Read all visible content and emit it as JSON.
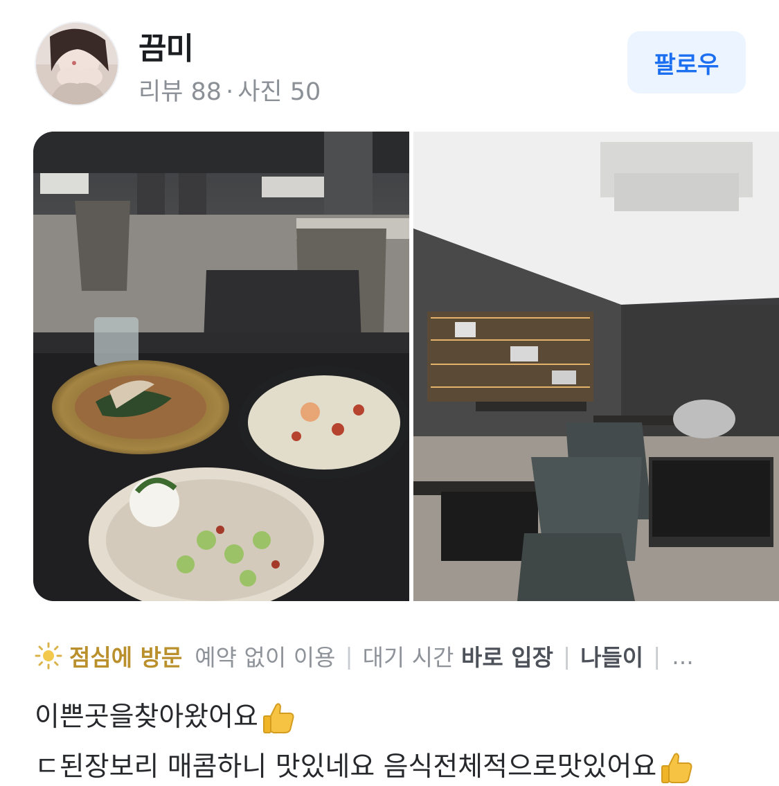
{
  "profile": {
    "name": "끔미",
    "review_label": "리뷰 88",
    "photo_label": "사진 50",
    "avatar_icon": "profile-avatar"
  },
  "follow": {
    "label": "팔로우"
  },
  "photos": [
    {
      "name": "food-photo"
    },
    {
      "name": "interior-photo"
    }
  ],
  "tags": {
    "visit_icon": "sun-icon",
    "visit": "점심에 방문",
    "reservation": "예약 없이 이용",
    "wait_prefix": "대기 시간",
    "wait_value": "바로 입장",
    "purpose": "나들이",
    "more": "..."
  },
  "review": {
    "line1": "이쁜곳을찾아왔어요",
    "line2": "ㄷ된장보리 매콤하니 맛있네요 음식전체적으로맛있어요",
    "emoji_icon": "thumbs-up-icon"
  },
  "colors": {
    "accent": "#1c6ff0",
    "follow_bg": "#ebf4ff",
    "visit_tag": "#b9902c",
    "muted": "#8e9299"
  }
}
